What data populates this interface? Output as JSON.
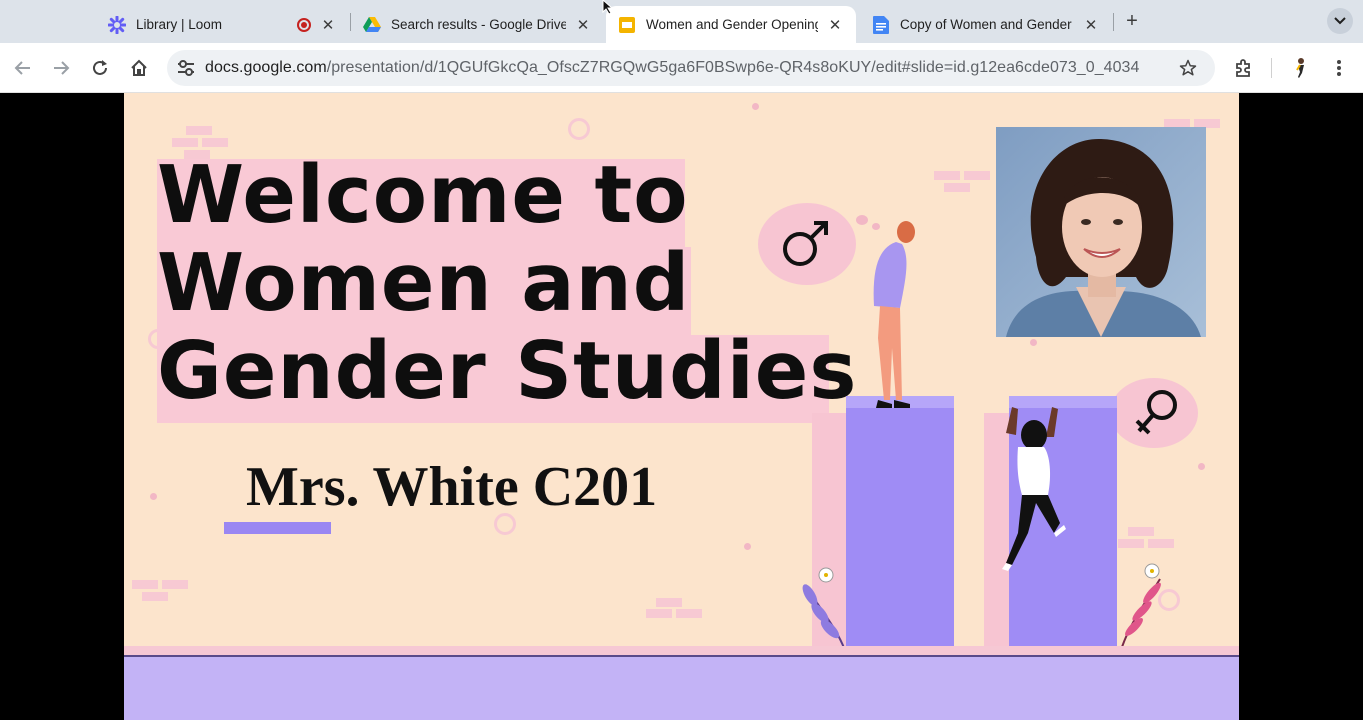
{
  "browser": {
    "tabs": [
      {
        "title": "Library | Loom",
        "icon": "loom-icon",
        "active": false,
        "recording": true
      },
      {
        "title": "Search results - Google Drive",
        "icon": "google-drive-icon",
        "active": false
      },
      {
        "title": "Women and Gender Opening",
        "icon": "google-slides-icon",
        "active": true
      },
      {
        "title": "Copy of Women and Gender S",
        "icon": "google-docs-icon",
        "active": false
      }
    ],
    "close_glyph": "✕",
    "new_tab_glyph": "+",
    "url_host": "docs.google.com",
    "url_path": "/presentation/d/1QGUfGkcQa_OfscZ7RGQwG5ga6F0BSwp6e-QR4s8oKUY/edit#slide=id.g12ea6cde073_0_4034"
  },
  "slide": {
    "title_lines": [
      "Welcome to",
      "Women and",
      "Gender Studies"
    ],
    "teacher": "Mrs. White C201",
    "male_symbol": "♂",
    "female_symbol": "♀",
    "colors": {
      "background": "#fce4cc",
      "highlight": "#f9c9d5",
      "pillar": "#9f8cf5",
      "floor": "#c3b3f6",
      "accent_bar": "#9a86f2"
    }
  }
}
